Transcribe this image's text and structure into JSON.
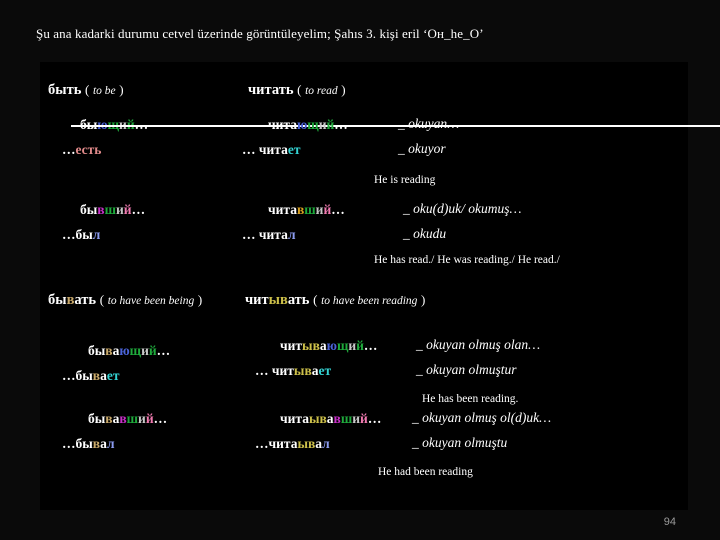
{
  "slide": {
    "title": "Şu ana kadarki durumu cetvel üzerinde görüntüleyelim; Şahıs 3. kişi eril ‘Он_he_O’",
    "page_number": "94",
    "background": "#0a0a0a",
    "panel_color": "#000000"
  },
  "palette": {
    "white": "#ffffff",
    "blue": "#4a63d8",
    "green": "#1faa3c",
    "grey": "#c8c8c8",
    "pink": "#f07ab0",
    "magenta": "#c830c8",
    "orange": "#d8a020",
    "yellow": "#cdc04a",
    "tan": "#c9a96a",
    "cyan": "#34d4d4",
    "lilac": "#8b9bf0",
    "page_grey": "#9b9b9b"
  },
  "columns": {
    "infinitive_be": {
      "word": "быть",
      "gloss": "to be",
      "open_paren": "(",
      "close_paren": ")"
    },
    "infinitive_read": {
      "word": "читать",
      "gloss": "to read",
      "open_paren": "(",
      "close_paren": ")"
    },
    "infinitive_been_being": {
      "word_parts": [
        {
          "text": "бы",
          "color": "#ffffff"
        },
        {
          "text": "в",
          "color": "#c9a96a"
        },
        {
          "text": "ать",
          "color": "#ffffff"
        }
      ],
      "gloss": "to have been being",
      "open_paren": "(",
      "close_paren": ")"
    },
    "infinitive_been_reading": {
      "word_parts": [
        {
          "text": "чит",
          "color": "#ffffff"
        },
        {
          "text": "ыв",
          "color": "#cdc04a"
        },
        {
          "text": "ать",
          "color": "#ffffff"
        }
      ],
      "gloss": "to have  been  reading",
      "open_paren": "(",
      "close_paren": ")"
    }
  },
  "rows": [
    {
      "id": "present-be-read",
      "be_participle": {
        "struck": true,
        "parts": [
          {
            "text": "бы",
            "color": "#ffffff"
          },
          {
            "text": "ю",
            "color": "#4a63d8"
          },
          {
            "text": "щ",
            "color": "#1faa3c"
          },
          {
            "text": "и",
            "color": "#c8c8c8"
          },
          {
            "text": "й",
            "color": "#1faa3c"
          },
          {
            "text": "…",
            "color": "#ffffff"
          }
        ]
      },
      "be_finite": {
        "parts": [
          {
            "text": "…",
            "color": "#ffffff"
          },
          {
            "text": "есть",
            "color": "#e08a8a"
          }
        ]
      },
      "read_participle": {
        "parts": [
          {
            "text": "чита",
            "color": "#ffffff"
          },
          {
            "text": "ю",
            "color": "#4a63d8"
          },
          {
            "text": "щ",
            "color": "#1faa3c"
          },
          {
            "text": "и",
            "color": "#c8c8c8"
          },
          {
            "text": "й",
            "color": "#1faa3c"
          },
          {
            "text": "…",
            "color": "#ffffff"
          }
        ]
      },
      "read_finite": {
        "parts": [
          {
            "text": "… чита",
            "color": "#ffffff"
          },
          {
            "text": "ет",
            "color": "#34d4d4"
          }
        ]
      },
      "turkish_participle": "_ okuyan…",
      "turkish_finite": "_ okuyor",
      "english": "He is reading"
    },
    {
      "id": "past-be-read",
      "be_participle": {
        "struck": false,
        "parts": [
          {
            "text": "бы",
            "color": "#ffffff"
          },
          {
            "text": "в",
            "color": "#c830c8"
          },
          {
            "text": "ш",
            "color": "#1faa3c"
          },
          {
            "text": "и",
            "color": "#c8c8c8"
          },
          {
            "text": "й",
            "color": "#f07ab0"
          },
          {
            "text": "…",
            "color": "#ffffff"
          }
        ]
      },
      "be_finite": {
        "parts": [
          {
            "text": "…бы",
            "color": "#ffffff"
          },
          {
            "text": "л",
            "color": "#8b9bf0"
          }
        ]
      },
      "read_participle": {
        "parts": [
          {
            "text": "чита",
            "color": "#ffffff"
          },
          {
            "text": "в",
            "color": "#d8a020"
          },
          {
            "text": "ш",
            "color": "#1faa3c"
          },
          {
            "text": "и",
            "color": "#c8c8c8"
          },
          {
            "text": "й",
            "color": "#f07ab0"
          },
          {
            "text": "…",
            "color": "#ffffff"
          }
        ]
      },
      "read_finite": {
        "parts": [
          {
            "text": "… чита",
            "color": "#ffffff"
          },
          {
            "text": "л",
            "color": "#8b9bf0"
          }
        ]
      },
      "turkish_participle": "_ oku(d)uk/ okumuş…",
      "turkish_finite": "_ okudu",
      "english": "He has  read./ He was reading./  He read./"
    },
    {
      "id": "present-iterative",
      "be_participle": {
        "struck": false,
        "parts": [
          {
            "text": "бы",
            "color": "#ffffff"
          },
          {
            "text": "в",
            "color": "#c9a96a"
          },
          {
            "text": "а",
            "color": "#ffffff"
          },
          {
            "text": "ю",
            "color": "#4a63d8"
          },
          {
            "text": "щ",
            "color": "#1faa3c"
          },
          {
            "text": "и",
            "color": "#c8c8c8"
          },
          {
            "text": "й",
            "color": "#1faa3c"
          },
          {
            "text": "…",
            "color": "#ffffff"
          }
        ]
      },
      "be_finite": {
        "parts": [
          {
            "text": "…бы",
            "color": "#ffffff"
          },
          {
            "text": "в",
            "color": "#c9a96a"
          },
          {
            "text": "а",
            "color": "#ffffff"
          },
          {
            "text": "ет",
            "color": "#34d4d4"
          }
        ]
      },
      "read_participle": {
        "parts": [
          {
            "text": "чит",
            "color": "#ffffff"
          },
          {
            "text": "ыв",
            "color": "#cdc04a"
          },
          {
            "text": "а",
            "color": "#ffffff"
          },
          {
            "text": "ю",
            "color": "#4a63d8"
          },
          {
            "text": "щ",
            "color": "#1faa3c"
          },
          {
            "text": "и",
            "color": "#c8c8c8"
          },
          {
            "text": "й",
            "color": "#1faa3c"
          },
          {
            "text": "…",
            "color": "#ffffff"
          }
        ]
      },
      "read_finite": {
        "parts": [
          {
            "text": "… чит",
            "color": "#ffffff"
          },
          {
            "text": "ыв",
            "color": "#cdc04a"
          },
          {
            "text": "а",
            "color": "#ffffff"
          },
          {
            "text": "ет",
            "color": "#34d4d4"
          }
        ]
      },
      "turkish_participle": "_ okuyan olmuş olan…",
      "turkish_finite": "_ okuyan olmuştur",
      "english": "He has been reading."
    },
    {
      "id": "past-iterative",
      "be_participle": {
        "struck": false,
        "parts": [
          {
            "text": "бы",
            "color": "#ffffff"
          },
          {
            "text": "в",
            "color": "#c9a96a"
          },
          {
            "text": "а",
            "color": "#ffffff"
          },
          {
            "text": "в",
            "color": "#c830c8"
          },
          {
            "text": "ш",
            "color": "#1faa3c"
          },
          {
            "text": "и",
            "color": "#c8c8c8"
          },
          {
            "text": "й",
            "color": "#f07ab0"
          },
          {
            "text": "…",
            "color": "#ffffff"
          }
        ]
      },
      "be_finite": {
        "parts": [
          {
            "text": "…бы",
            "color": "#ffffff"
          },
          {
            "text": "в",
            "color": "#c9a96a"
          },
          {
            "text": "а",
            "color": "#ffffff"
          },
          {
            "text": "л",
            "color": "#8b9bf0"
          }
        ]
      },
      "read_participle": {
        "parts": [
          {
            "text": "чита",
            "color": "#ffffff"
          },
          {
            "text": "ыв",
            "color": "#cdc04a"
          },
          {
            "text": "а",
            "color": "#ffffff"
          },
          {
            "text": "в",
            "color": "#c830c8"
          },
          {
            "text": "ш",
            "color": "#1faa3c"
          },
          {
            "text": "и",
            "color": "#c8c8c8"
          },
          {
            "text": "й",
            "color": "#f07ab0"
          },
          {
            "text": "…",
            "color": "#ffffff"
          }
        ]
      },
      "read_finite": {
        "parts": [
          {
            "text": "…чита",
            "color": "#ffffff"
          },
          {
            "text": "ыв",
            "color": "#cdc04a"
          },
          {
            "text": "а",
            "color": "#ffffff"
          },
          {
            "text": "л",
            "color": "#8b9bf0"
          }
        ]
      },
      "turkish_participle": "_ okuyan olmuş ol(d)uk…",
      "turkish_finite": "_ okuyan olmuştu",
      "english": "He had  been reading"
    }
  ]
}
